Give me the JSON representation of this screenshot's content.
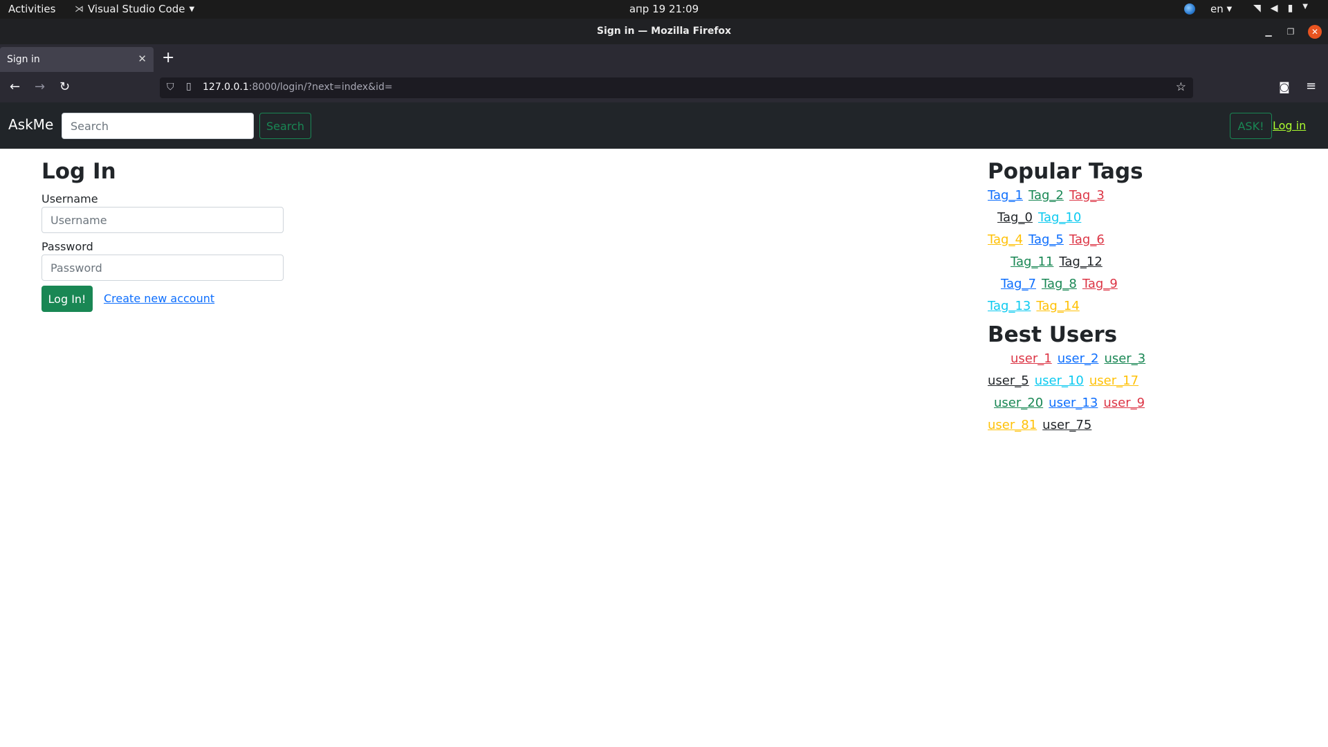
{
  "system_bar": {
    "activities": "Activities",
    "app_name": "Visual Studio Code",
    "clock": "апр 19  21:09",
    "language": "en"
  },
  "window": {
    "title": "Sign in — Mozilla Firefox"
  },
  "browser": {
    "tab_title": "Sign in",
    "url_host": "127.0.0.1",
    "url_rest": ":8000/login/?next=index&id="
  },
  "site_nav": {
    "brand": "AskMe",
    "search_placeholder": "Search",
    "search_button": "Search",
    "ask_button": "ASK!",
    "login_link": "Log in"
  },
  "login_form": {
    "heading": "Log In",
    "username_label": "Username",
    "username_placeholder": "Username",
    "password_label": "Password",
    "password_placeholder": "Password",
    "submit_label": "Log In!",
    "create_account_link": "Create new account"
  },
  "sidebar": {
    "popular_tags_heading": "Popular Tags",
    "tag_rows": [
      [
        {
          "label": "Tag_1",
          "color": "#0d6efd"
        },
        {
          "label": "Tag_2",
          "color": "#198754"
        },
        {
          "label": "Tag_3",
          "color": "#dc3545"
        }
      ],
      [
        {
          "label": "Tag_0",
          "color": "#212529"
        },
        {
          "label": "Tag_10",
          "color": "#0dcaf0"
        }
      ],
      [
        {
          "label": "Tag_4",
          "color": "#ffc107"
        },
        {
          "label": "Tag_5",
          "color": "#0d6efd"
        },
        {
          "label": "Tag_6",
          "color": "#dc3545"
        }
      ],
      [
        {
          "label": "Tag_11",
          "color": "#198754"
        },
        {
          "label": "Tag_12",
          "color": "#212529"
        }
      ],
      [
        {
          "label": "Tag_7",
          "color": "#0d6efd"
        },
        {
          "label": "Tag_8",
          "color": "#198754"
        },
        {
          "label": "Tag_9",
          "color": "#dc3545"
        }
      ],
      [
        {
          "label": "Tag_13",
          "color": "#0dcaf0"
        },
        {
          "label": "Tag_14",
          "color": "#ffc107"
        }
      ]
    ],
    "best_users_heading": "Best Users",
    "user_rows": [
      [
        {
          "label": "user_1",
          "color": "#dc3545"
        },
        {
          "label": "user_2",
          "color": "#0d6efd"
        },
        {
          "label": "user_3",
          "color": "#198754"
        }
      ],
      [
        {
          "label": "user_5",
          "color": "#212529"
        },
        {
          "label": "user_10",
          "color": "#0dcaf0"
        },
        {
          "label": "user_17",
          "color": "#ffc107"
        }
      ],
      [
        {
          "label": "user_20",
          "color": "#198754"
        },
        {
          "label": "user_13",
          "color": "#0d6efd"
        },
        {
          "label": "user_9",
          "color": "#dc3545"
        }
      ],
      [
        {
          "label": "user_81",
          "color": "#ffc107"
        },
        {
          "label": "user_75",
          "color": "#212529"
        }
      ]
    ]
  }
}
